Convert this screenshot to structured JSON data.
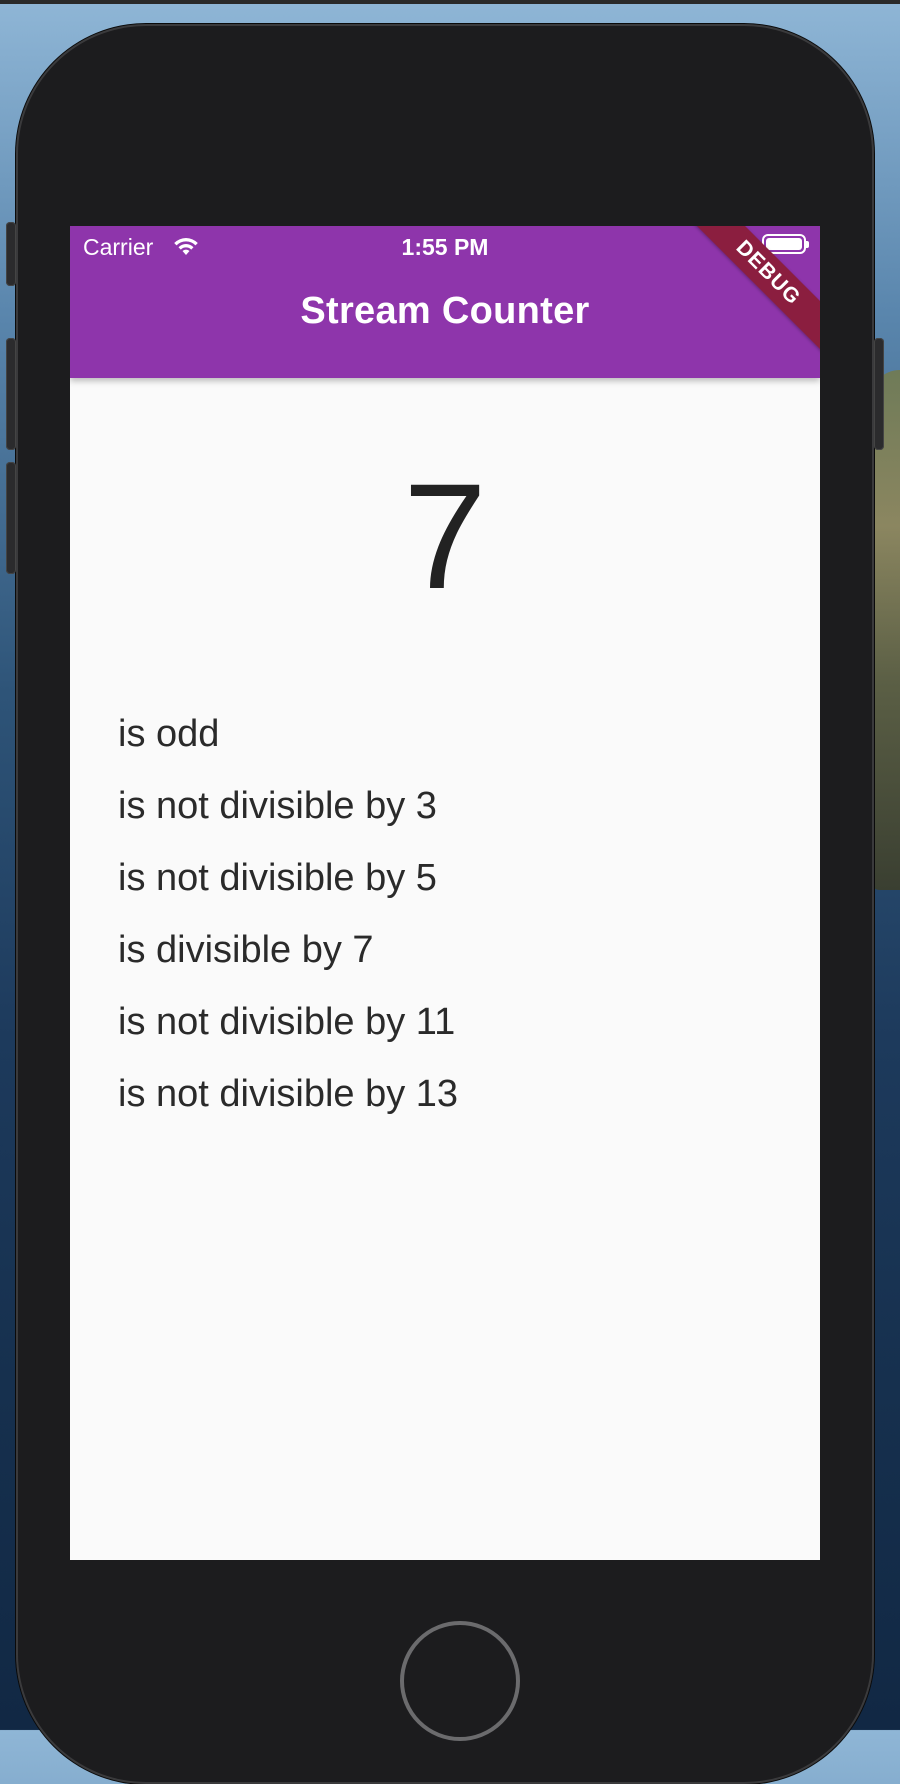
{
  "status_bar": {
    "carrier": "Carrier",
    "time": "1:55 PM",
    "wifi_icon": "wifi-icon",
    "battery_icon": "battery-icon"
  },
  "app_bar": {
    "title": "Stream Counter",
    "color": "#8e35ab",
    "debug_banner": "DEBUG"
  },
  "main": {
    "counter_value": "7",
    "facts": [
      "is odd",
      "is not divisible by 3",
      "is not divisible by 5",
      "is divisible by 7",
      "is not divisible by 11",
      "is not divisible by 13"
    ]
  }
}
